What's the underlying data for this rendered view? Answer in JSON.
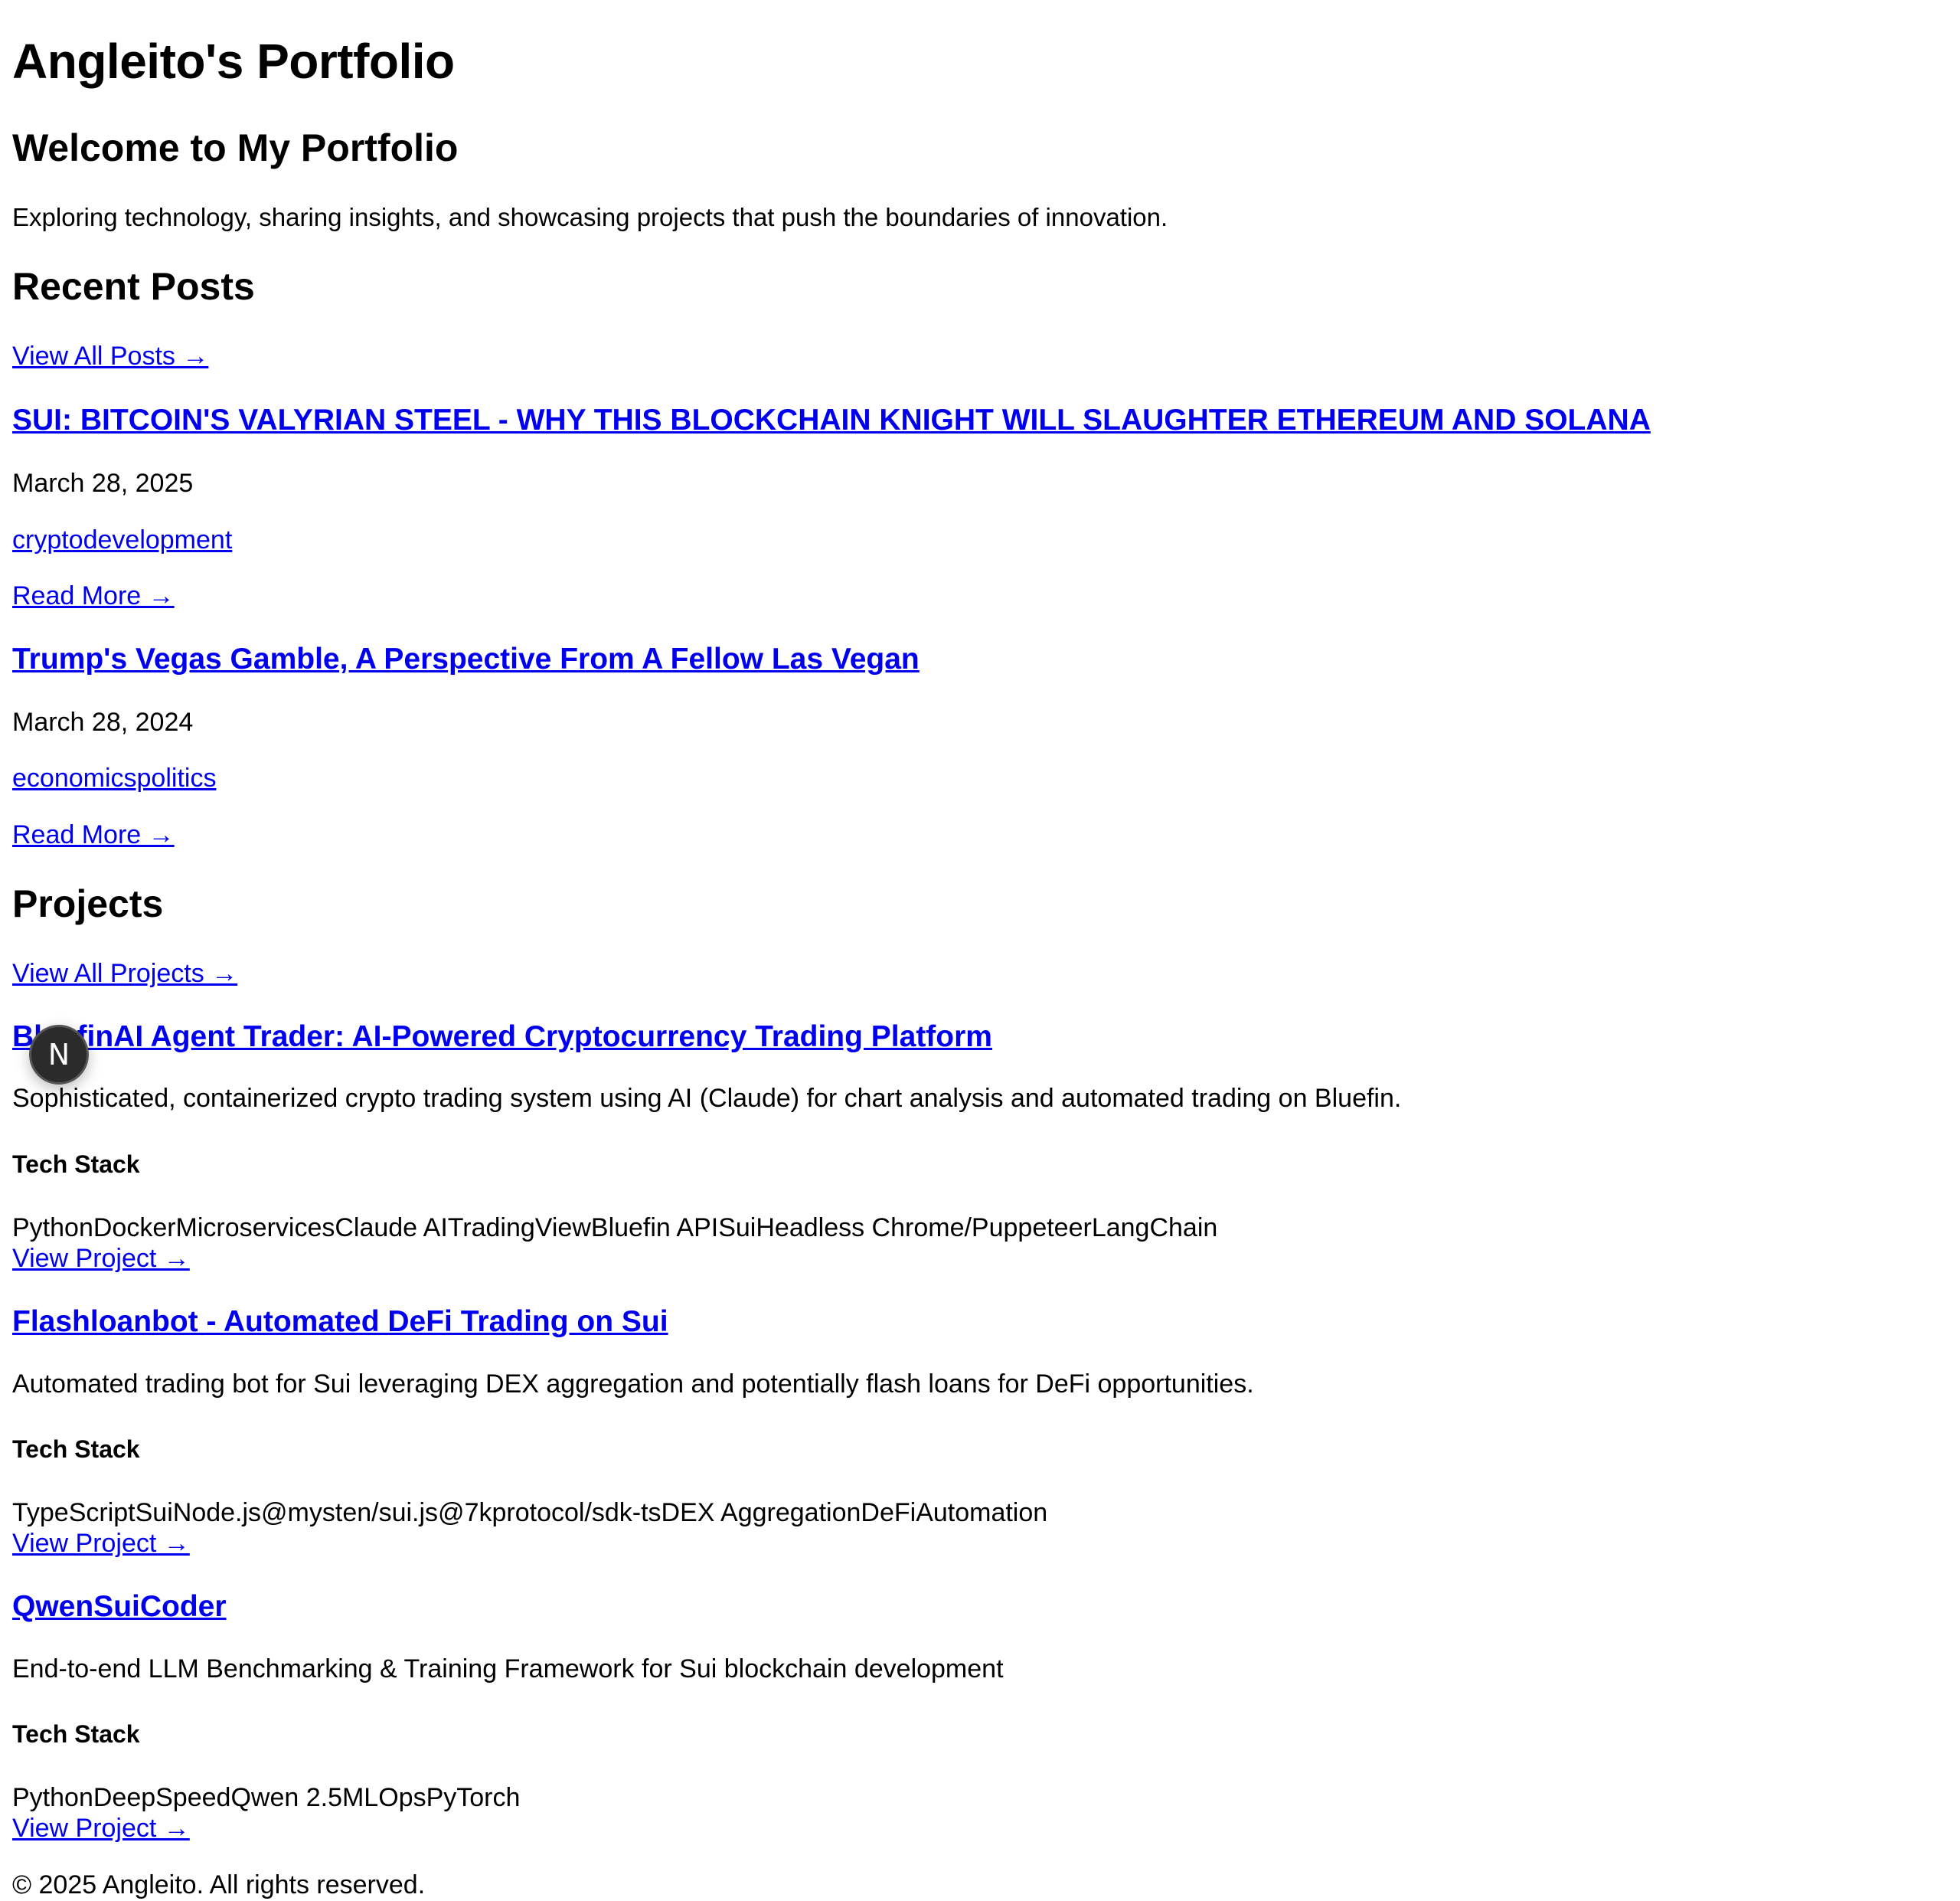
{
  "site": {
    "title": "Angleito's Portfolio"
  },
  "hero": {
    "heading": "Welcome to My Portfolio",
    "intro": "Exploring technology, sharing insights, and showcasing projects that push the boundaries of innovation."
  },
  "posts_section": {
    "heading": "Recent Posts",
    "view_all": "View All Posts →",
    "posts": [
      {
        "title": "SUI: BITCOIN'S VALYRIAN STEEL - WHY THIS BLOCKCHAIN KNIGHT WILL SLAUGHTER ETHEREUM AND SOLANA",
        "date": "March 28, 2025",
        "tags": "cryptodevelopment",
        "read_more": "Read More →"
      },
      {
        "title": "Trump's Vegas Gamble, A Perspective From A Fellow Las Vegan",
        "date": "March 28, 2024",
        "tags": "economicspolitics",
        "read_more": "Read More →"
      }
    ]
  },
  "projects_section": {
    "heading": "Projects",
    "view_all": "View All Projects →",
    "projects": [
      {
        "title": "BluefinAI Agent Trader: AI-Powered Cryptocurrency Trading Platform",
        "description": "Sophisticated, containerized crypto trading system using AI (Claude) for chart analysis and automated trading on Bluefin.",
        "stack_heading": "Tech Stack",
        "stack": "PythonDockerMicroservicesClaude AITradingViewBluefin APISuiHeadless Chrome/PuppeteerLangChain",
        "view": "View Project →"
      },
      {
        "title": "Flashloanbot - Automated DeFi Trading on Sui",
        "description": "Automated trading bot for Sui leveraging DEX aggregation and potentially flash loans for DeFi opportunities.",
        "stack_heading": "Tech Stack",
        "stack": "TypeScriptSuiNode.js@mysten/sui.js@7kprotocol/sdk-tsDEX AggregationDeFiAutomation",
        "view": "View Project →"
      },
      {
        "title": "QwenSuiCoder",
        "description": "End-to-end LLM Benchmarking & Training Framework for Sui blockchain development",
        "stack_heading": "Tech Stack",
        "stack": "PythonDeepSpeedQwen 2.5MLOpsPyTorch",
        "view": "View Project →"
      }
    ]
  },
  "footer": {
    "copyright": "© 2025 Angleito. All rights reserved."
  },
  "overlay": {
    "badge_letter": "N",
    "badge_icon": "nextjs-dev-indicator-icon"
  }
}
